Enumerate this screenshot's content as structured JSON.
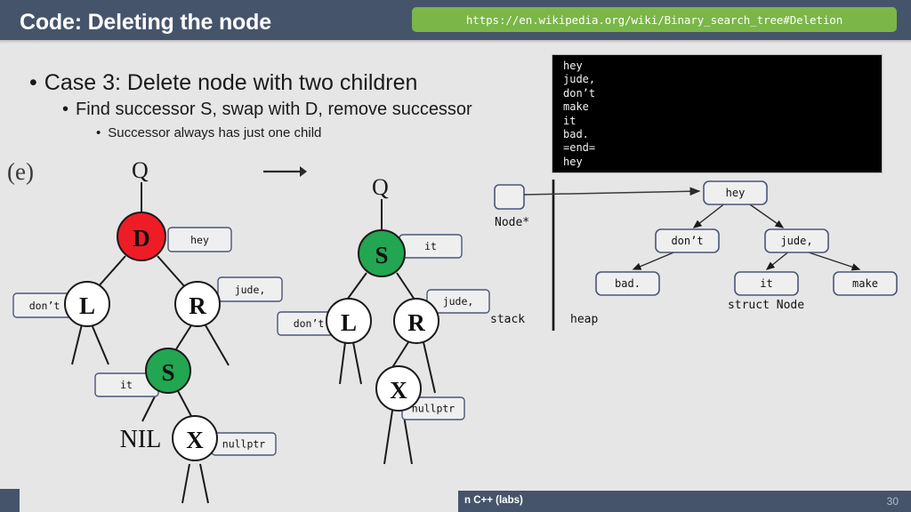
{
  "header": {
    "title": "Code: Deleting the node",
    "url_badge": "https://en.wikipedia.org/wiki/Binary_search_tree#Deletion",
    "bar_color": "#45546b",
    "badge_color": "#7ab648"
  },
  "bullets": {
    "level1": "Case 3: Delete node with two children",
    "level2": "Find successor S, swap with D, remove successor",
    "level3": "Successor always has just one child",
    "marker": "•"
  },
  "terminal": {
    "lines": [
      "hey",
      "jude,",
      "don’t",
      "make",
      "it",
      "bad.",
      "=end=",
      "hey"
    ],
    "background": "#000000",
    "text_color": "#f2f2f2"
  },
  "diagram": {
    "step_label": "(e)",
    "transition_arrow": "→",
    "tree_before": {
      "root_pointer_label": "Q",
      "nodes": [
        {
          "id": "D",
          "label": "D",
          "fill": "#ee1c25",
          "tag": "hey",
          "tag_side": "right"
        },
        {
          "id": "L",
          "label": "L",
          "fill": "#ffffff",
          "tag": "don’t",
          "tag_side": "left"
        },
        {
          "id": "R",
          "label": "R",
          "fill": "#ffffff",
          "tag": "jude,",
          "tag_side": "right"
        },
        {
          "id": "S",
          "label": "S",
          "fill": "#22a651",
          "tag": "it",
          "tag_side": "left"
        },
        {
          "id": "NIL",
          "label": "NIL",
          "fill": "none",
          "tag": "",
          "tag_side": ""
        },
        {
          "id": "X",
          "label": "X",
          "fill": "#ffffff",
          "tag": "nullptr",
          "tag_side": "right"
        }
      ]
    },
    "tree_after": {
      "root_pointer_label": "Q",
      "nodes": [
        {
          "id": "S",
          "label": "S",
          "fill": "#22a651",
          "tag": "it",
          "tag_side": "right"
        },
        {
          "id": "L",
          "label": "L",
          "fill": "#ffffff",
          "tag": "don’t",
          "tag_side": "left"
        },
        {
          "id": "R",
          "label": "R",
          "fill": "#ffffff",
          "tag": "jude,",
          "tag_side": "right"
        },
        {
          "id": "X",
          "label": "X",
          "fill": "#ffffff",
          "tag": "nullptr",
          "tag_side": "right"
        }
      ]
    },
    "memory": {
      "stack_label": "stack",
      "heap_label": "heap",
      "pointer_type_label": "Node*",
      "struct_label": "struct Node",
      "heap_nodes": [
        {
          "id": "hey",
          "label": "hey"
        },
        {
          "id": "dont",
          "label": "don’t"
        },
        {
          "id": "jude",
          "label": "jude,"
        },
        {
          "id": "bad",
          "label": "bad."
        },
        {
          "id": "it",
          "label": "it"
        },
        {
          "id": "make",
          "label": "make"
        }
      ]
    }
  },
  "footer": {
    "course": "n C++ (labs)",
    "page_number": "30"
  }
}
